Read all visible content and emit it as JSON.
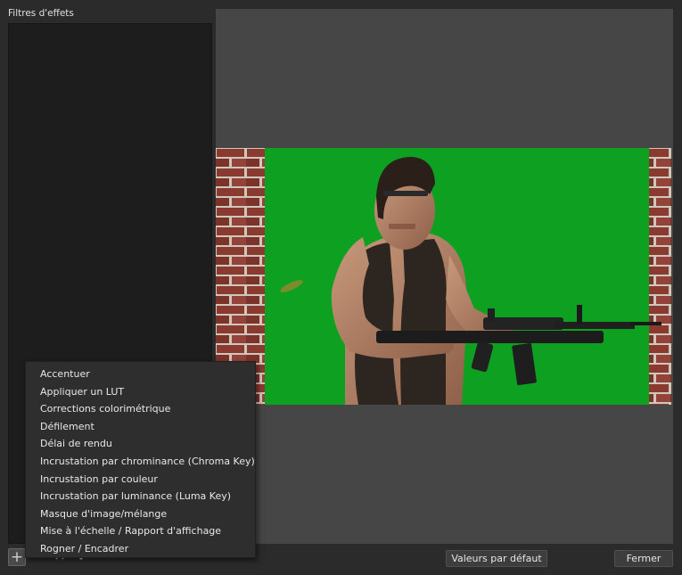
{
  "panel": {
    "title": "Filtres d'effets"
  },
  "menu": {
    "items": [
      "Accentuer",
      "Appliquer un LUT",
      "Corrections colorimétrique",
      "Défilement",
      "Délai de rendu",
      "Incrustation par chrominance (Chroma Key)",
      "Incrustation par couleur",
      "Incrustation par luminance (Luma Key)",
      "Masque d'image/mélange",
      "Mise à l'échelle / Rapport d'affichage",
      "Rogner / Encadrer"
    ]
  },
  "buttons": {
    "defaults": "Valeurs par défaut",
    "close": "Fermer"
  },
  "icons": {
    "add": "plus-icon",
    "remove": "minus-icon",
    "move_up": "chevron-up-icon",
    "move_down": "chevron-down-icon"
  },
  "colors": {
    "chroma_green": "#0ea121",
    "brick": "#8a3a2f",
    "mortar": "#cfc6bc"
  }
}
